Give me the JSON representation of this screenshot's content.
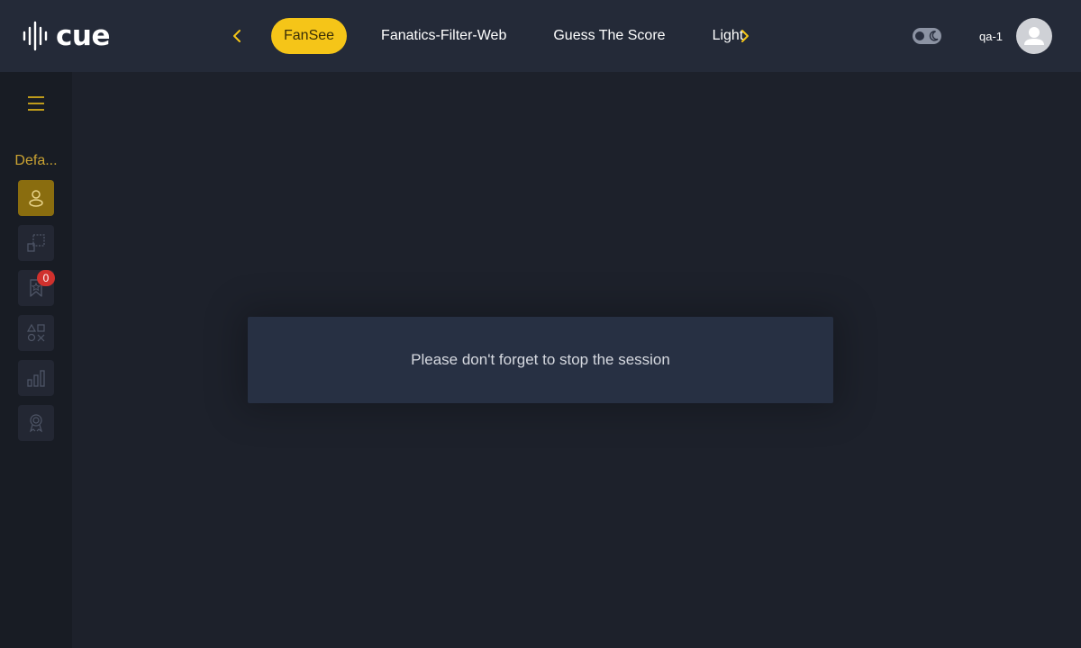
{
  "header": {
    "logo_text": "cue",
    "tabs": [
      {
        "label": "FanSee",
        "active": true
      },
      {
        "label": "Fanatics-Filter-Web",
        "active": false
      },
      {
        "label": "Guess The Score",
        "active": false
      },
      {
        "label": "Light",
        "active": false
      }
    ],
    "username": "qa-1",
    "theme": "dark"
  },
  "sidebar": {
    "workspace_label": "Defa...",
    "items": [
      {
        "name": "user",
        "active": true
      },
      {
        "name": "layout",
        "active": false
      },
      {
        "name": "bookmarks",
        "badge": "0",
        "active": false
      },
      {
        "name": "shapes",
        "active": false
      },
      {
        "name": "analytics",
        "active": false
      },
      {
        "name": "awards",
        "active": false
      }
    ]
  },
  "notice": {
    "message": "Please don't forget to stop the session"
  },
  "colors": {
    "accent": "#f5c518",
    "sidebar_bg": "#181c24",
    "topbar_bg": "#242a38",
    "page_bg": "#1d212b",
    "badge": "#d0312d"
  }
}
